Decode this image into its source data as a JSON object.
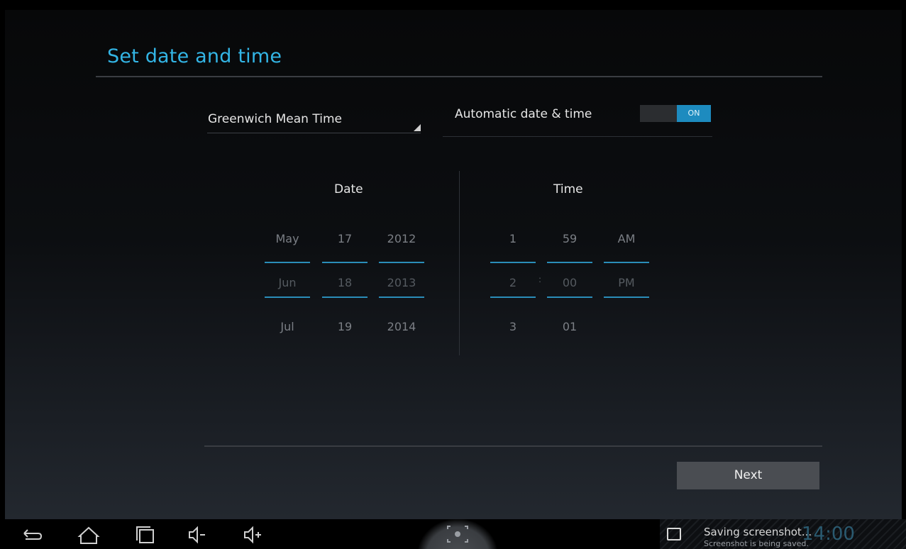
{
  "title": "Set date and time",
  "timezone": {
    "value": "Greenwich Mean Time"
  },
  "auto": {
    "label": "Automatic date & time",
    "switch_state": "ON"
  },
  "date": {
    "title": "Date",
    "month": [
      "May",
      "Jun",
      "Jul"
    ],
    "day": [
      "17",
      "18",
      "19"
    ],
    "year": [
      "2012",
      "2013",
      "2014"
    ]
  },
  "time": {
    "title": "Time",
    "hour": [
      "1",
      "2",
      "3"
    ],
    "separator": ":",
    "minute": [
      "59",
      "00",
      "01"
    ],
    "ampm": [
      "AM",
      "PM"
    ]
  },
  "next_label": "Next",
  "navbar": {
    "notification_title": "Saving screenshot...",
    "notification_sub": "Screenshot is being saved.",
    "clock": "14:00"
  },
  "colors": {
    "accent": "#33b5e5",
    "switch_on": "#1d8bbf"
  }
}
